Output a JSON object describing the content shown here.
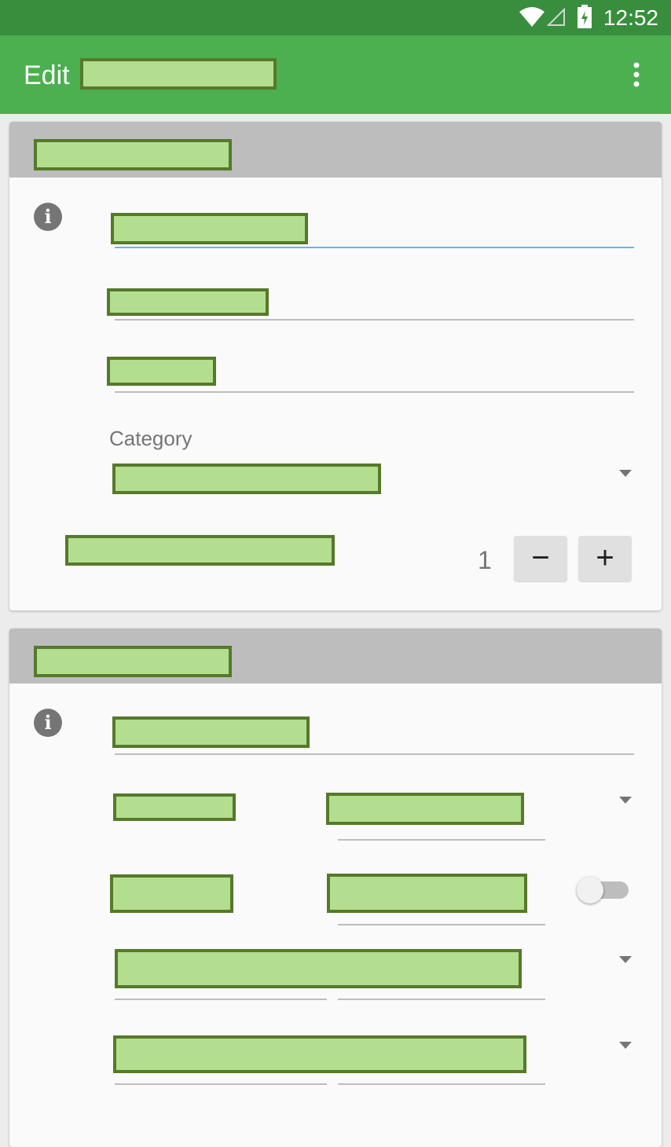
{
  "status_bar": {
    "time": "12:52",
    "icons": [
      "wifi-icon",
      "cell-signal-icon",
      "battery-icon"
    ]
  },
  "app_bar": {
    "title_prefix": "Edit",
    "overflow_icon": "more-vert-icon"
  },
  "section1": {
    "category_label": "Category",
    "quantity_value": "1",
    "decrement_label": "−",
    "increment_label": "+"
  },
  "icons": {
    "info": "i"
  },
  "colors": {
    "status_bar": "#388e3c",
    "app_bar": "#4caf50",
    "active_underline": "#64b5f6",
    "card_header": "#bdbdbd"
  }
}
